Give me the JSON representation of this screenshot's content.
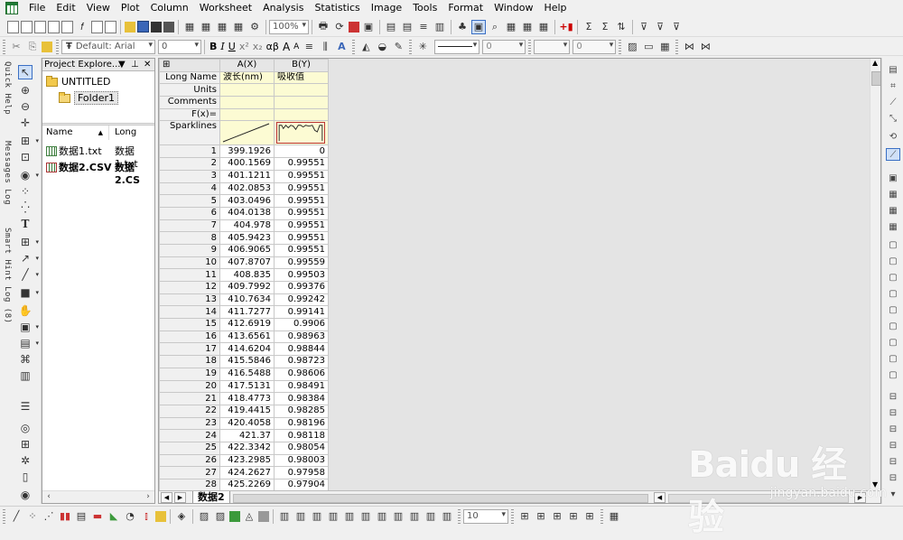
{
  "menu": [
    "File",
    "Edit",
    "View",
    "Plot",
    "Column",
    "Worksheet",
    "Analysis",
    "Statistics",
    "Image",
    "Tools",
    "Format",
    "Window",
    "Help"
  ],
  "toolbar1": {
    "zoom": "100%"
  },
  "toolbar2": {
    "font_name": "Default: Arial",
    "font_size": "0",
    "line_width": "0",
    "line_width2": "0",
    "bold": "B",
    "italic": "I",
    "underline": "U",
    "superscript": "x²",
    "subscript": "x₂",
    "greek": "αβ",
    "grow_font": "A",
    "shrink_font": "A"
  },
  "left_tabs": [
    "Quick Help",
    "Messages Log",
    "Smart Hint Log (8)"
  ],
  "project_explorer": {
    "title": "Project Explore...",
    "tree": {
      "root": "UNTITLED",
      "folder": "Folder1"
    },
    "columns": [
      "Name",
      "Long Nam"
    ],
    "items": [
      {
        "name": "数据1.txt",
        "long_name": "数据1.txt",
        "bold": false
      },
      {
        "name": "数据2.CSV",
        "long_name": "数据2.CS",
        "bold": true
      }
    ]
  },
  "worksheet": {
    "corner": "⊞",
    "columns": [
      "A(X)",
      "B(Y)"
    ],
    "meta_rows": [
      {
        "label": "Long Name",
        "values": [
          "波长(nm)",
          "吸收值"
        ]
      },
      {
        "label": "Units",
        "values": [
          "",
          ""
        ]
      },
      {
        "label": "Comments",
        "values": [
          "",
          ""
        ]
      },
      {
        "label": "F(x)=",
        "values": [
          "",
          ""
        ]
      }
    ],
    "sparklines_label": "Sparklines",
    "rows": [
      [
        "1",
        "399.1926",
        "0"
      ],
      [
        "2",
        "400.1569",
        "0.99551"
      ],
      [
        "3",
        "401.1211",
        "0.99551"
      ],
      [
        "4",
        "402.0853",
        "0.99551"
      ],
      [
        "5",
        "403.0496",
        "0.99551"
      ],
      [
        "6",
        "404.0138",
        "0.99551"
      ],
      [
        "7",
        "404.978",
        "0.99551"
      ],
      [
        "8",
        "405.9423",
        "0.99551"
      ],
      [
        "9",
        "406.9065",
        "0.99551"
      ],
      [
        "10",
        "407.8707",
        "0.99559"
      ],
      [
        "11",
        "408.835",
        "0.99503"
      ],
      [
        "12",
        "409.7992",
        "0.99376"
      ],
      [
        "13",
        "410.7634",
        "0.99242"
      ],
      [
        "14",
        "411.7277",
        "0.99141"
      ],
      [
        "15",
        "412.6919",
        "0.9906"
      ],
      [
        "16",
        "413.6561",
        "0.98963"
      ],
      [
        "17",
        "414.6204",
        "0.98844"
      ],
      [
        "18",
        "415.5846",
        "0.98723"
      ],
      [
        "19",
        "416.5488",
        "0.98606"
      ],
      [
        "20",
        "417.5131",
        "0.98491"
      ],
      [
        "21",
        "418.4773",
        "0.98384"
      ],
      [
        "22",
        "419.4415",
        "0.98285"
      ],
      [
        "23",
        "420.4058",
        "0.98196"
      ],
      [
        "24",
        "421.37",
        "0.98118"
      ],
      [
        "25",
        "422.3342",
        "0.98054"
      ],
      [
        "26",
        "423.2985",
        "0.98003"
      ],
      [
        "27",
        "424.2627",
        "0.97958"
      ],
      [
        "28",
        "425.2269",
        "0.97904"
      ]
    ],
    "sheet_tab": "数据2"
  },
  "bottom_toolbar": {
    "size": "10"
  },
  "watermark": {
    "logo": "Baidu 经验",
    "url": "jingyan.baidu.com"
  },
  "colors": {
    "selection": "#cfe0f7",
    "meta_bg": "#fcfbd3",
    "accent": "#3a6fc4"
  }
}
